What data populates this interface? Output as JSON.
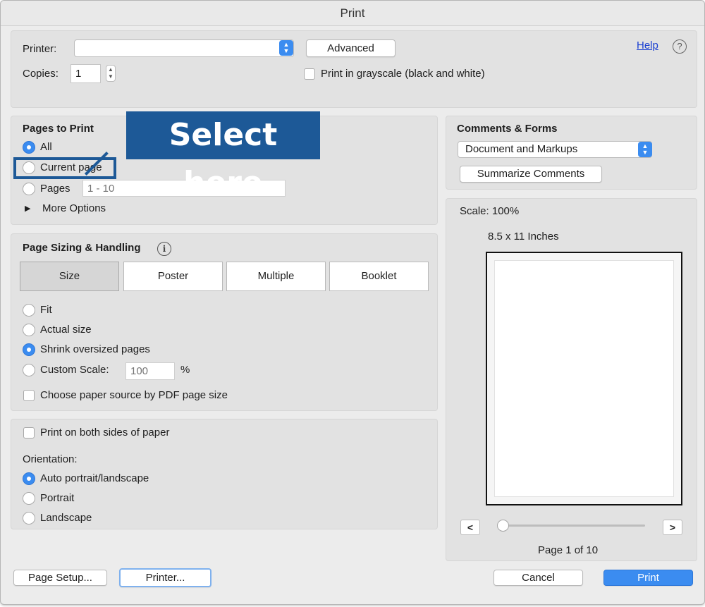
{
  "window": {
    "title": "Print"
  },
  "top": {
    "printer_label": "Printer:",
    "printer_value": "",
    "advanced_label": "Advanced",
    "help_label": "Help",
    "help_icon": "?",
    "copies_label": "Copies:",
    "copies_value": "1",
    "grayscale_label": "Print in grayscale (black and white)"
  },
  "pages_to_print": {
    "heading": "Pages to Print",
    "options": {
      "all": "All",
      "current": "Current page",
      "pages": "Pages"
    },
    "selected": "all",
    "pages_placeholder": "1 - 10",
    "more_options": "More Options"
  },
  "annotation": {
    "text": "Select here",
    "color": "#1d5997"
  },
  "sizing": {
    "heading": "Page Sizing & Handling",
    "info_icon": "i",
    "tabs": [
      "Size",
      "Poster",
      "Multiple",
      "Booklet"
    ],
    "active_tab": "Size",
    "options": {
      "fit": "Fit",
      "actual": "Actual size",
      "shrink": "Shrink oversized pages",
      "custom": "Custom Scale:"
    },
    "selected": "shrink",
    "custom_scale_placeholder": "100",
    "percent": "%",
    "paper_source_label": "Choose paper source by PDF page size"
  },
  "layout": {
    "both_sides_label": "Print on both sides of paper",
    "orientation_label": "Orientation:",
    "options": {
      "auto": "Auto portrait/landscape",
      "portrait": "Portrait",
      "landscape": "Landscape"
    },
    "selected": "auto"
  },
  "comments": {
    "heading": "Comments & Forms",
    "select_value": "Document and Markups",
    "summarize_label": "Summarize Comments"
  },
  "preview": {
    "scale_label": "Scale: 100%",
    "paper_size": "8.5 x 11 Inches",
    "prev": "<",
    "next": ">",
    "page_label": "Page 1 of 10"
  },
  "footer": {
    "page_setup": "Page Setup...",
    "printer_btn": "Printer...",
    "cancel": "Cancel",
    "print": "Print"
  },
  "colors": {
    "accent": "#3b8cf0",
    "print_button": "#3b8cf0"
  }
}
